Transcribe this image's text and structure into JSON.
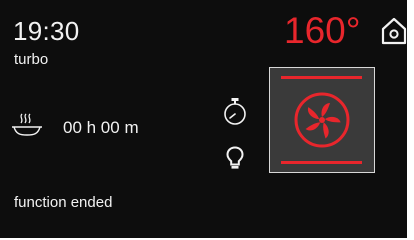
{
  "display": {
    "time": "19:30",
    "mode": "turbo",
    "temperature": "160°",
    "duration": "00 h 00 m",
    "status": "function ended"
  },
  "colors": {
    "background": "#0d0d0d",
    "text": "#f2f2f2",
    "accent": "#e8262c",
    "panel": "#3a3a3a"
  },
  "icons": {
    "home": "home-icon",
    "dish": "dish-icon",
    "timer": "stopwatch-icon",
    "light": "light-bulb-icon",
    "fan": "turbo-fan-icon"
  }
}
